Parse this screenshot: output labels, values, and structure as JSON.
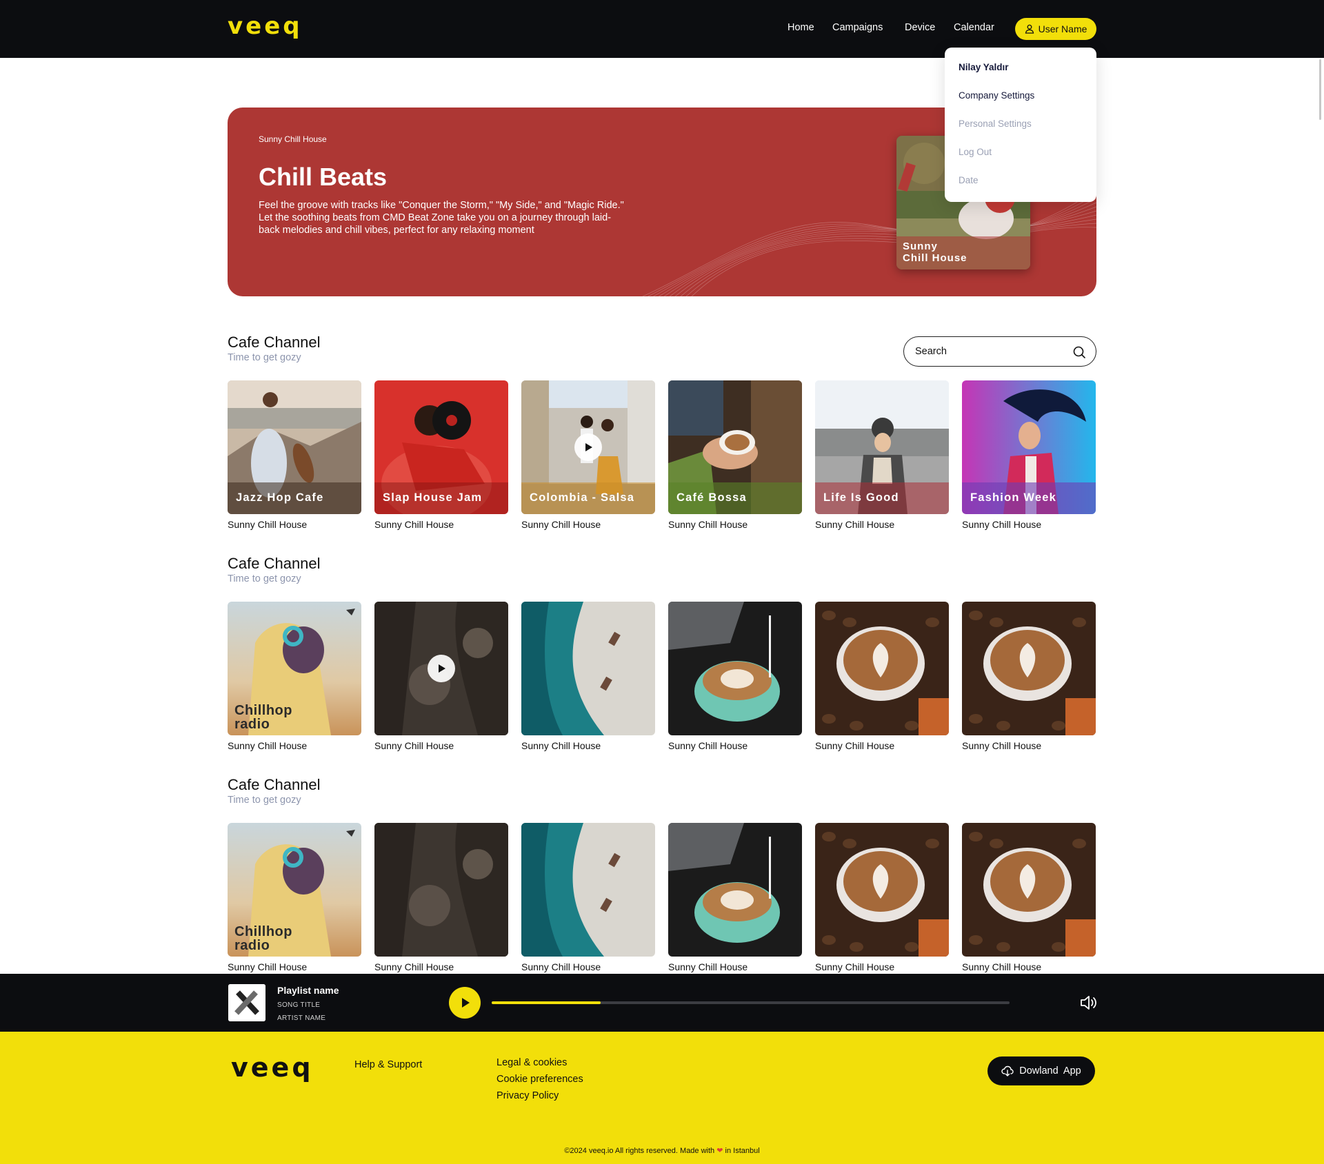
{
  "header": {
    "logo": "veeq",
    "nav": [
      "Home",
      "Campaigns",
      "Device",
      "Calendar"
    ],
    "user_button": "User Name"
  },
  "dropdown": {
    "user": "Nilay Yaldır",
    "items": [
      "Company Settings",
      "Personal Settings",
      "Log Out",
      "Date"
    ]
  },
  "hero": {
    "kicker": "Sunny Chill House",
    "title": "Chill Beats",
    "description": "Feel the groove with tracks like \"Conquer the Storm,\" \"My Side,\" and \"Magic Ride.\" Let the soothing beats from CMD Beat Zone take you on a journey through laid-back melodies and chill vibes, perfect for any relaxing moment",
    "card_caption_1": "Sunny",
    "card_caption_2": "Chill House"
  },
  "search": {
    "placeholder": "Search"
  },
  "sections": [
    {
      "title": "Cafe Channel",
      "subtitle": "Time to get gozy",
      "cards": [
        {
          "caption": "Jazz Hop Cafe",
          "subtitle": "Sunny Chill House"
        },
        {
          "caption": "Slap House Jam",
          "subtitle": "Sunny Chill House"
        },
        {
          "caption": "Colombia - Salsa",
          "subtitle": "Sunny Chill House"
        },
        {
          "caption": "Café Bossa",
          "subtitle": "Sunny Chill House"
        },
        {
          "caption": "Life Is Good",
          "subtitle": "Sunny Chill House"
        },
        {
          "caption": "Fashion Week",
          "subtitle": "Sunny Chill House"
        }
      ]
    },
    {
      "title": "Cafe Channel",
      "subtitle": "Time to get gozy",
      "cards": [
        {
          "caption1": "Chillhop",
          "caption2": "radio",
          "subtitle": "Sunny Chill House"
        },
        {
          "subtitle": "Sunny Chill House"
        },
        {
          "subtitle": "Sunny Chill House"
        },
        {
          "subtitle": "Sunny Chill House"
        },
        {
          "subtitle": "Sunny Chill House"
        },
        {
          "subtitle": "Sunny Chill House"
        }
      ]
    },
    {
      "title": "Cafe Channel",
      "subtitle": "Time to get gozy",
      "cards": [
        {
          "caption1": "Chillhop",
          "caption2": "radio",
          "subtitle": "Sunny Chill House"
        },
        {
          "subtitle": "Sunny Chill House"
        },
        {
          "subtitle": "Sunny Chill House"
        },
        {
          "subtitle": "Sunny Chill House"
        },
        {
          "subtitle": "Sunny Chill House"
        },
        {
          "subtitle": "Sunny Chill House"
        }
      ]
    }
  ],
  "player": {
    "playlist_name": "Playlist name",
    "song_title": "SONG TITLE",
    "artist_name": "ARTIST NAME",
    "progress": 0.21
  },
  "footer": {
    "logo": "veeq",
    "help": "Help & Support",
    "legal": [
      "Legal & cookies",
      "Cookie preferences",
      "Privacy Policy"
    ],
    "download": "Dowland  App",
    "copyright_prefix": "©2024 veeq.io All rights reserved. Made with",
    "copyright_suffix": "in Istanbul"
  },
  "colors": {
    "accent": "#f2df0a",
    "dark": "#0c0d10",
    "hero": "#ad3734",
    "muted": "#8d95ad"
  }
}
